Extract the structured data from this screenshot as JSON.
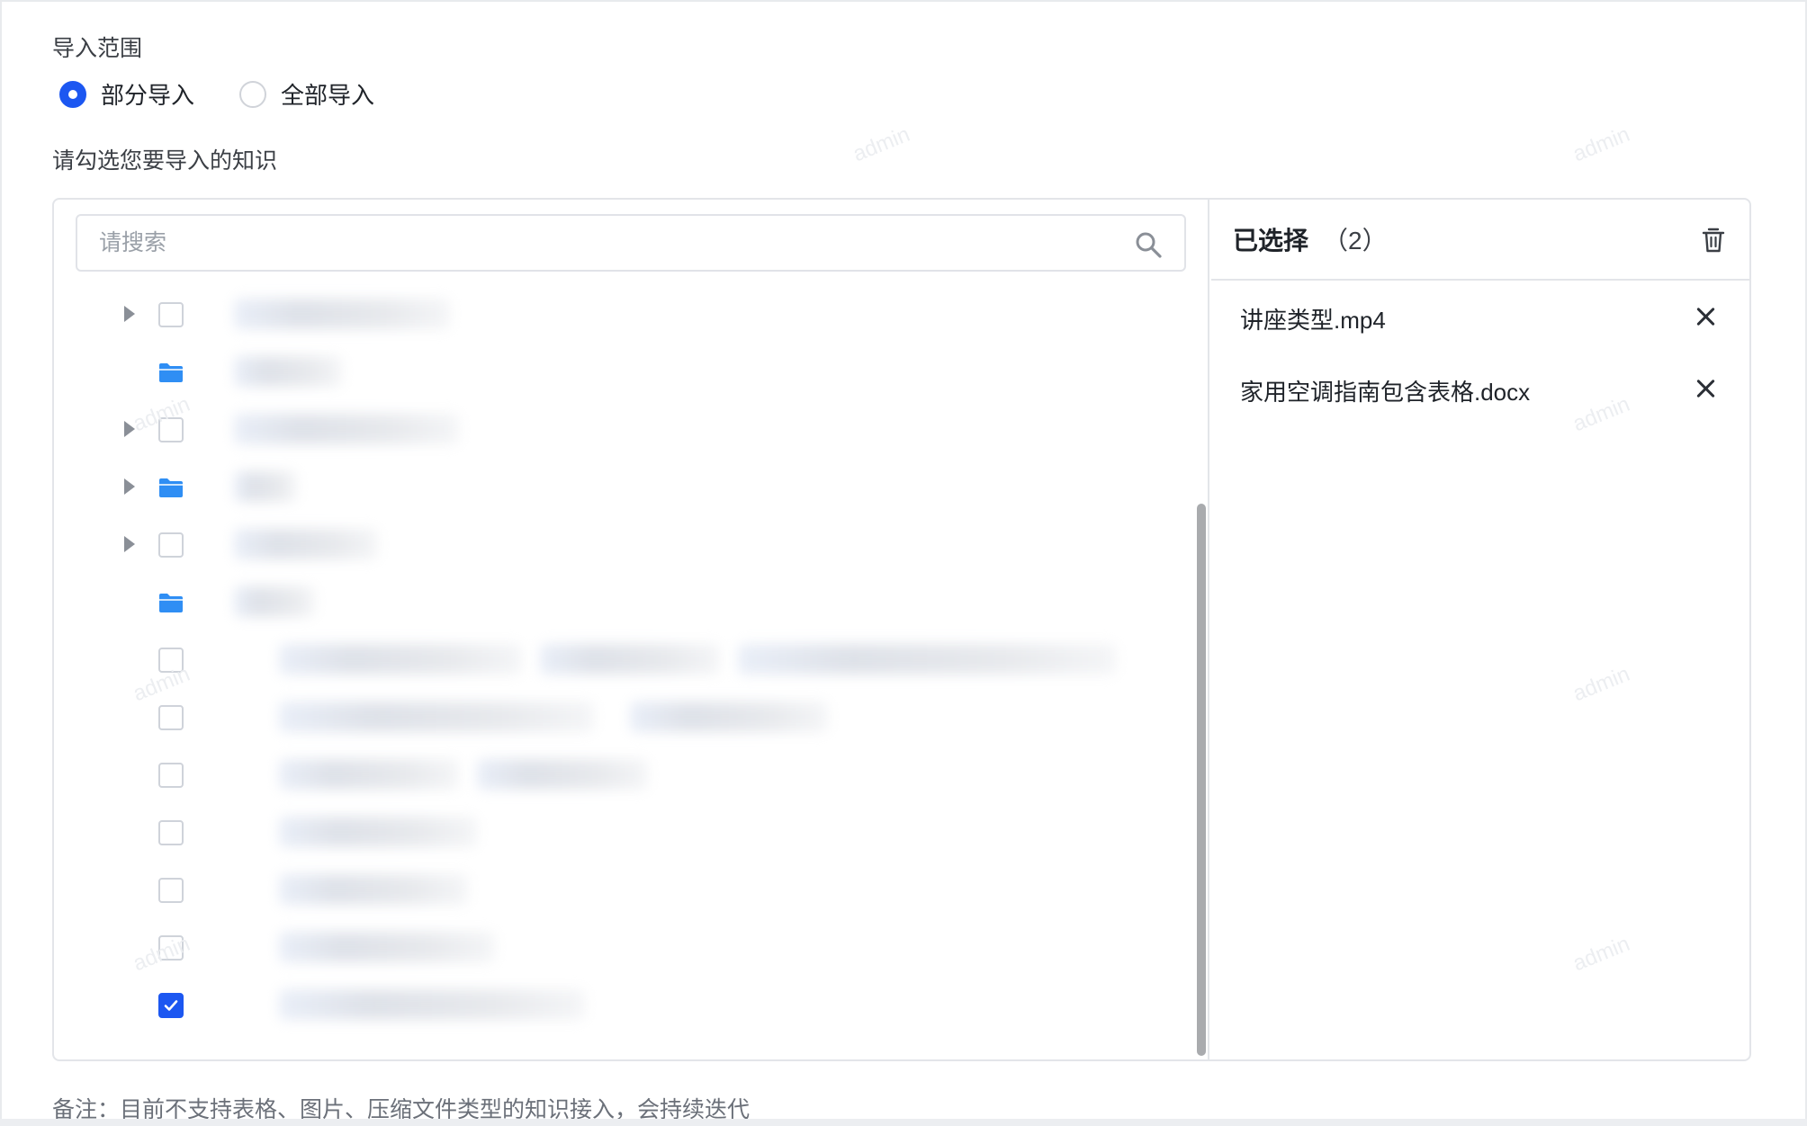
{
  "import_range": {
    "label": "导入范围",
    "options": [
      {
        "label": "部分导入",
        "checked": true
      },
      {
        "label": "全部导入",
        "checked": false
      }
    ]
  },
  "select_prompt": "请勾选您要导入的知识",
  "search": {
    "placeholder": "请搜索",
    "value": ""
  },
  "tree": {
    "rows": [
      {
        "type": "file",
        "expandable": true,
        "checked": false
      },
      {
        "type": "folder",
        "expandable": false,
        "checked": false
      },
      {
        "type": "file",
        "expandable": true,
        "checked": false
      },
      {
        "type": "folder",
        "expandable": true,
        "checked": false
      },
      {
        "type": "file",
        "expandable": true,
        "checked": false
      },
      {
        "type": "folder",
        "expandable": false,
        "checked": false
      },
      {
        "type": "file",
        "expandable": false,
        "checked": false
      },
      {
        "type": "file",
        "expandable": false,
        "checked": false
      },
      {
        "type": "file",
        "expandable": false,
        "checked": false
      },
      {
        "type": "file",
        "expandable": false,
        "checked": false
      },
      {
        "type": "file",
        "expandable": false,
        "checked": false
      },
      {
        "type": "file",
        "expandable": false,
        "checked": false
      },
      {
        "type": "file",
        "expandable": false,
        "checked": true
      }
    ]
  },
  "selected": {
    "title": "已选择",
    "count": "（2）",
    "items": [
      {
        "name": "讲座类型.mp4"
      },
      {
        "name": "家用空调指南包含表格.docx"
      }
    ]
  },
  "note": "备注：目前不支持表格、图片、压缩文件类型的知识接入，会持续迭代",
  "watermark": "admin",
  "colors": {
    "accent": "#1c57f1",
    "folder": "#2f8ef4",
    "border": "#e3e5e9"
  },
  "icons": [
    "search-icon",
    "trash-icon",
    "close-icon",
    "folder-icon",
    "caret-right-icon",
    "checkmark-icon"
  ]
}
